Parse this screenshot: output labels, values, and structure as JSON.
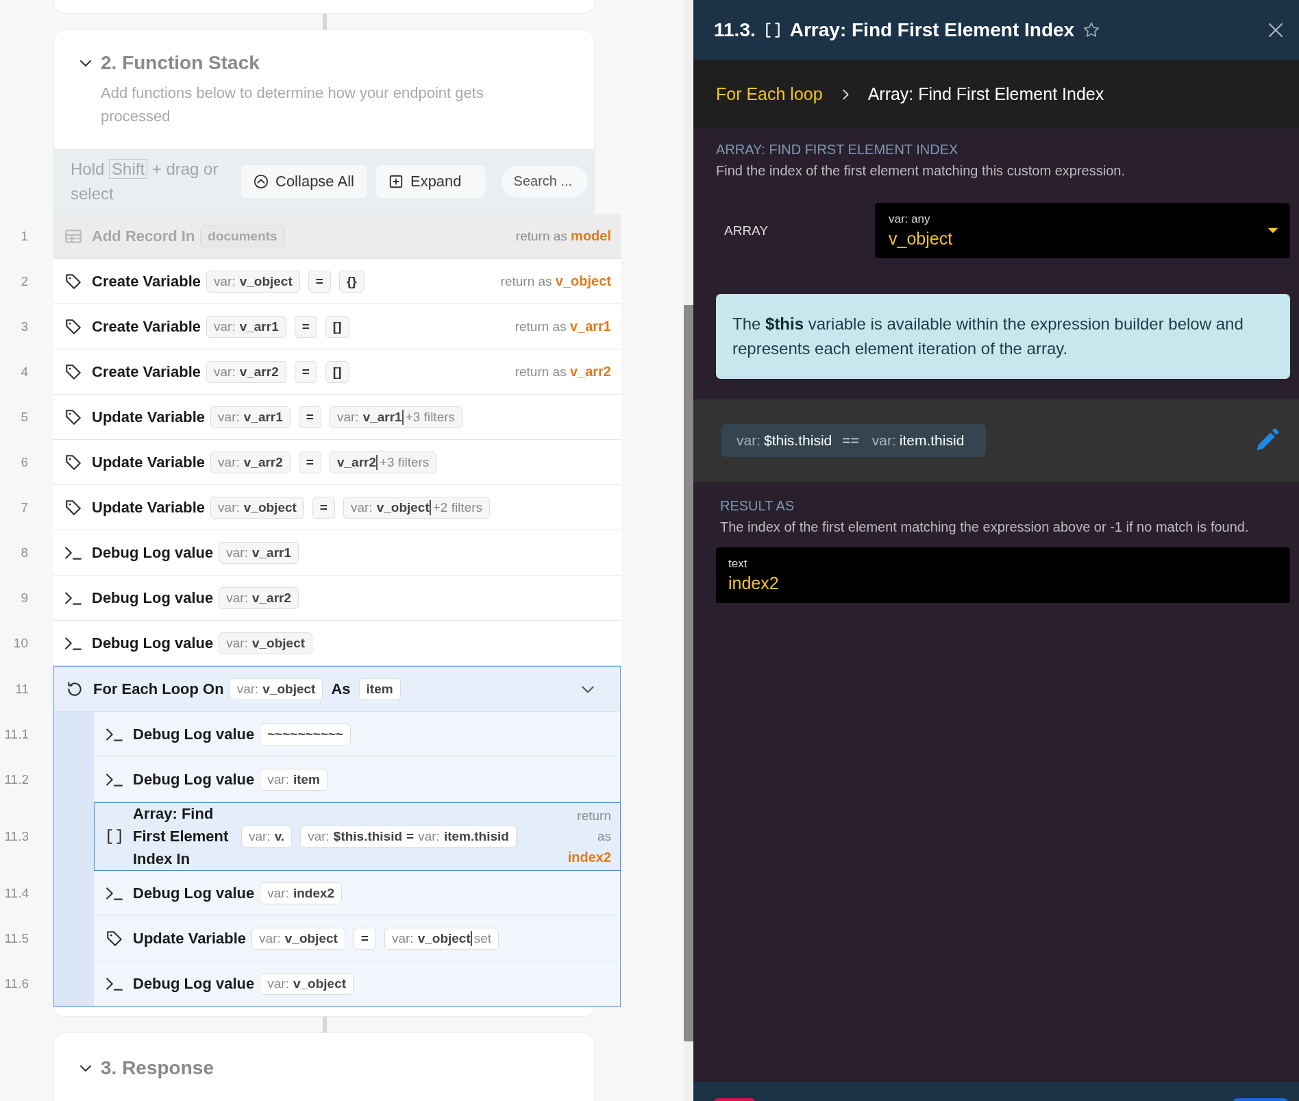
{
  "function_stack": {
    "title": "2. Function Stack",
    "expanded": true,
    "description": "Add functions below to determine how your endpoint gets processed",
    "toolbar": {
      "hint_before": "Hold",
      "hint_key": "Shift",
      "hint_after": "+ drag or select",
      "buttons": [
        {
          "kind": "collapse",
          "label": "Collapse All"
        },
        {
          "kind": "expand",
          "label": "Expand"
        }
      ],
      "search": {
        "placeholder": "Search ..."
      }
    },
    "steps": [
      {
        "number": "1",
        "kind": "table",
        "title": "Add Record In",
        "disabled": true,
        "selected": false,
        "parts": [
          {
            "kind": "chip",
            "segments": [
              {
                "kind": "value",
                "text": "documents"
              }
            ]
          }
        ],
        "return": {
          "label": "return as",
          "value": "model"
        }
      },
      {
        "number": "2",
        "kind": "tag",
        "title": "Create Variable",
        "disabled": false,
        "selected": false,
        "parts": [
          {
            "kind": "chip",
            "segments": [
              {
                "kind": "label",
                "text": "var:"
              },
              {
                "kind": "value",
                "text": "v_object"
              }
            ]
          },
          {
            "kind": "op",
            "text": "="
          },
          {
            "kind": "op",
            "text": "{}"
          }
        ],
        "return": {
          "label": "return as",
          "value": "v_object"
        }
      },
      {
        "number": "3",
        "kind": "tag",
        "title": "Create Variable",
        "disabled": false,
        "selected": false,
        "parts": [
          {
            "kind": "chip",
            "segments": [
              {
                "kind": "label",
                "text": "var:"
              },
              {
                "kind": "value",
                "text": "v_arr1"
              }
            ]
          },
          {
            "kind": "op",
            "text": "="
          },
          {
            "kind": "op",
            "text": "[]"
          }
        ],
        "return": {
          "label": "return as",
          "value": "v_arr1"
        }
      },
      {
        "number": "4",
        "kind": "tag",
        "title": "Create Variable",
        "disabled": false,
        "selected": false,
        "parts": [
          {
            "kind": "chip",
            "segments": [
              {
                "kind": "label",
                "text": "var:"
              },
              {
                "kind": "value",
                "text": "v_arr2"
              }
            ]
          },
          {
            "kind": "op",
            "text": "="
          },
          {
            "kind": "op",
            "text": "[]"
          }
        ],
        "return": {
          "label": "return as",
          "value": "v_arr2"
        }
      },
      {
        "number": "5",
        "kind": "tag",
        "title": "Update Variable",
        "disabled": false,
        "selected": false,
        "parts": [
          {
            "kind": "chip",
            "segments": [
              {
                "kind": "label",
                "text": "var:"
              },
              {
                "kind": "value",
                "text": "v_arr1"
              }
            ]
          },
          {
            "kind": "op",
            "text": "="
          },
          {
            "kind": "chip",
            "segments": [
              {
                "kind": "label",
                "text": "var:"
              },
              {
                "kind": "value",
                "text": "v_arr1"
              },
              {
                "kind": "filter",
                "text": "+3 filters"
              }
            ]
          }
        ]
      },
      {
        "number": "6",
        "kind": "tag",
        "title": "Update Variable",
        "disabled": false,
        "selected": false,
        "parts": [
          {
            "kind": "chip",
            "segments": [
              {
                "kind": "label",
                "text": "var:"
              },
              {
                "kind": "value",
                "text": "v_arr2"
              }
            ]
          },
          {
            "kind": "op",
            "text": "="
          },
          {
            "kind": "chip",
            "segments": [
              {
                "kind": "value",
                "text": "v_arr2"
              },
              {
                "kind": "filter",
                "text": "+3 filters"
              }
            ]
          }
        ]
      },
      {
        "number": "7",
        "kind": "tag",
        "title": "Update Variable",
        "disabled": false,
        "selected": false,
        "parts": [
          {
            "kind": "chip",
            "segments": [
              {
                "kind": "label",
                "text": "var:"
              },
              {
                "kind": "value",
                "text": "v_object"
              }
            ]
          },
          {
            "kind": "op",
            "text": "="
          },
          {
            "kind": "chip",
            "segments": [
              {
                "kind": "label",
                "text": "var:"
              },
              {
                "kind": "value",
                "text": "v_object"
              },
              {
                "kind": "filter",
                "text": "+2 filters"
              }
            ]
          }
        ]
      },
      {
        "number": "8",
        "kind": "terminal",
        "title": "Debug Log value",
        "disabled": false,
        "selected": false,
        "parts": [
          {
            "kind": "chip",
            "segments": [
              {
                "kind": "label",
                "text": "var:"
              },
              {
                "kind": "value",
                "text": "v_arr1"
              }
            ]
          }
        ]
      },
      {
        "number": "9",
        "kind": "terminal",
        "title": "Debug Log value",
        "disabled": false,
        "selected": false,
        "parts": [
          {
            "kind": "chip",
            "segments": [
              {
                "kind": "label",
                "text": "var:"
              },
              {
                "kind": "value",
                "text": "v_arr2"
              }
            ]
          }
        ]
      },
      {
        "number": "10",
        "kind": "terminal",
        "title": "Debug Log value",
        "disabled": false,
        "selected": false,
        "parts": [
          {
            "kind": "chip",
            "segments": [
              {
                "kind": "label",
                "text": "var:"
              },
              {
                "kind": "value",
                "text": "v_object"
              }
            ]
          }
        ]
      },
      {
        "number": "11",
        "kind": "loop",
        "title": "For Each Loop On",
        "disabled": false,
        "selected": false,
        "expanded": true,
        "parts": [
          {
            "kind": "chip",
            "segments": [
              {
                "kind": "label",
                "text": "var:"
              },
              {
                "kind": "value",
                "text": "v_object"
              }
            ]
          },
          {
            "kind": "word",
            "text": "As"
          },
          {
            "kind": "chip",
            "segments": [
              {
                "kind": "value",
                "text": "item"
              }
            ]
          }
        ],
        "children": [
          {
            "number": "11.1",
            "kind": "terminal",
            "title": "Debug Log value",
            "disabled": false,
            "selected": false,
            "parts": [
              {
                "kind": "chip",
                "segments": [
                  {
                    "kind": "value",
                    "text": "~~~~~~~~~~"
                  }
                ]
              }
            ]
          },
          {
            "number": "11.2",
            "kind": "terminal",
            "title": "Debug Log value",
            "disabled": false,
            "selected": false,
            "parts": [
              {
                "kind": "chip",
                "segments": [
                  {
                    "kind": "label",
                    "text": "var:"
                  },
                  {
                    "kind": "value",
                    "text": "item"
                  }
                ]
              }
            ]
          },
          {
            "number": "11.3",
            "kind": "brackets",
            "title": "Array: Find First Element Index In",
            "disabled": false,
            "selected": true,
            "parts": [
              {
                "kind": "chip",
                "segments": [
                  {
                    "kind": "label",
                    "text": "var:"
                  },
                  {
                    "kind": "value",
                    "text": "v."
                  }
                ]
              },
              {
                "kind": "chip",
                "segments": [
                  {
                    "kind": "label",
                    "text": "var:"
                  },
                  {
                    "kind": "value",
                    "text": "$this.thisid"
                  },
                  {
                    "kind": "op",
                    "text": "="
                  },
                  {
                    "kind": "label",
                    "text": "var:"
                  },
                  {
                    "kind": "value",
                    "text": "item.thisid"
                  }
                ]
              }
            ],
            "return": {
              "label": "return as",
              "value": "index2"
            }
          },
          {
            "number": "11.4",
            "kind": "terminal",
            "title": "Debug Log value",
            "disabled": false,
            "selected": false,
            "parts": [
              {
                "kind": "chip",
                "segments": [
                  {
                    "kind": "label",
                    "text": "var:"
                  },
                  {
                    "kind": "value",
                    "text": "index2"
                  }
                ]
              }
            ]
          },
          {
            "number": "11.5",
            "kind": "tag",
            "title": "Update Variable",
            "disabled": false,
            "selected": false,
            "parts": [
              {
                "kind": "chip",
                "segments": [
                  {
                    "kind": "label",
                    "text": "var:"
                  },
                  {
                    "kind": "value",
                    "text": "v_object"
                  }
                ]
              },
              {
                "kind": "op",
                "text": "="
              },
              {
                "kind": "chip",
                "segments": [
                  {
                    "kind": "label",
                    "text": "var:"
                  },
                  {
                    "kind": "value",
                    "text": "v_object"
                  },
                  {
                    "kind": "filter",
                    "text": "set"
                  }
                ]
              }
            ]
          },
          {
            "number": "11.6",
            "kind": "terminal",
            "title": "Debug Log value",
            "disabled": false,
            "selected": false,
            "parts": [
              {
                "kind": "chip",
                "segments": [
                  {
                    "kind": "label",
                    "text": "var:"
                  },
                  {
                    "kind": "value",
                    "text": "v_object"
                  }
                ]
              }
            ]
          }
        ]
      }
    ]
  },
  "response": {
    "title": "3. Response",
    "expanded": true
  },
  "panel": {
    "number": "11.3.",
    "title": "Array: Find First Element Index",
    "starred": false,
    "breadcrumb": [
      {
        "text": "For Each loop",
        "selected": false
      },
      {
        "text": "Array: Find First Element Index",
        "selected": true
      }
    ],
    "heading": "ARRAY: FIND FIRST ELEMENT INDEX",
    "description": "Find the index of the first element matching this custom expression.",
    "inputs": [
      {
        "label": "ARRAY",
        "type": "var: any",
        "value": "v_object"
      }
    ],
    "info": "The **$this** variable is available within the expression builder below and represents each element iteration of the array.",
    "expression": [
      {
        "kind": "label",
        "text": "var:"
      },
      {
        "kind": "value",
        "text": "$this.thisid"
      },
      {
        "kind": "op",
        "text": "=="
      },
      {
        "kind": "label",
        "text": "var:"
      },
      {
        "kind": "value",
        "text": "item.thisid"
      }
    ],
    "result": {
      "heading": "RESULT AS",
      "description": "The index of the first element matching the expression above or -1 if no match is found.",
      "type": "text",
      "value": "index2"
    }
  }
}
